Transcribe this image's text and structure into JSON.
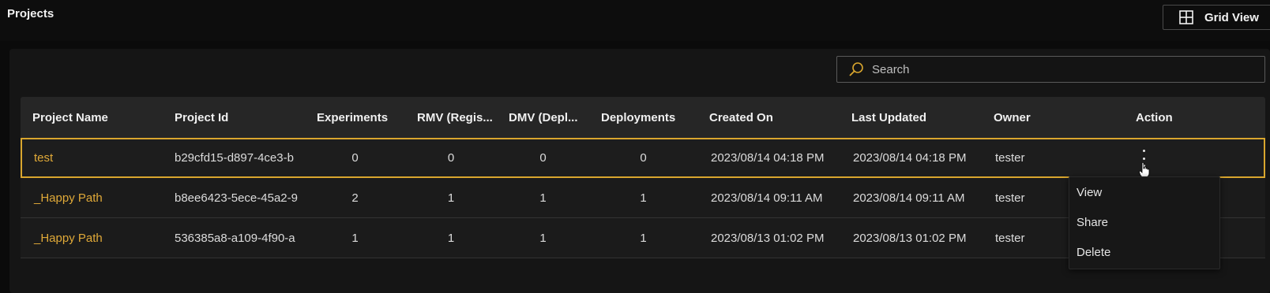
{
  "header": {
    "title": "Projects",
    "grid_view_label": "Grid View",
    "grid_view_icon": "grid-icon"
  },
  "search": {
    "placeholder": "Search",
    "value": "",
    "icon": "search-icon",
    "accent": "#d9a62e"
  },
  "table": {
    "columns": [
      "Project Name",
      "Project Id",
      "Experiments",
      "RMV (Regis...",
      "DMV (Depl...",
      "Deployments",
      "Created On",
      "Last Updated",
      "Owner",
      "Action"
    ],
    "rows": [
      {
        "name": "test",
        "id": "b29cfd15-d897-4ce3-b",
        "experiments": "0",
        "rmv": "0",
        "dmv": "0",
        "deployments": "0",
        "created": "2023/08/14 04:18 PM",
        "updated": "2023/08/14 04:18 PM",
        "owner": "tester",
        "selected": true
      },
      {
        "name": "_Happy Path",
        "id": "b8ee6423-5ece-45a2-9",
        "experiments": "2",
        "rmv": "1",
        "dmv": "1",
        "deployments": "1",
        "created": "2023/08/14 09:11 AM",
        "updated": "2023/08/14 09:11 AM",
        "owner": "tester",
        "selected": false
      },
      {
        "name": "_Happy Path",
        "id": "536385a8-a109-4f90-a",
        "experiments": "1",
        "rmv": "1",
        "dmv": "1",
        "deployments": "1",
        "created": "2023/08/13 01:02 PM",
        "updated": "2023/08/13 01:02 PM",
        "owner": "tester",
        "selected": false
      }
    ]
  },
  "action_menu": {
    "items": [
      "View",
      "Share",
      "Delete"
    ]
  },
  "colors": {
    "accent": "#d9a62e",
    "background": "#0b0b0b"
  }
}
